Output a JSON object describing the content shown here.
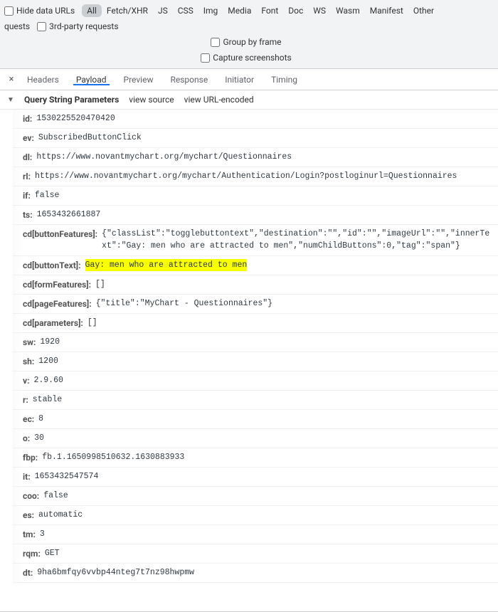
{
  "filterbar": {
    "hide_data_urls": "Hide data URLs",
    "chips": [
      "All",
      "Fetch/XHR",
      "JS",
      "CSS",
      "Img",
      "Media",
      "Font",
      "Doc",
      "WS",
      "Wasm",
      "Manifest",
      "Other"
    ],
    "active_chip": "All",
    "requests_suffix": "quests",
    "third_party": "3rd-party requests",
    "group_by_frame": "Group by frame",
    "capture_screenshots": "Capture screenshots"
  },
  "tabs": {
    "items": [
      "Headers",
      "Payload",
      "Preview",
      "Response",
      "Initiator",
      "Timing"
    ],
    "active": "Payload",
    "close": "×"
  },
  "section": {
    "caret": "▼",
    "title": "Query String Parameters",
    "view_source": "view source",
    "view_url_encoded": "view URL-encoded"
  },
  "params": [
    {
      "key": "id:",
      "val": "1530225520470420"
    },
    {
      "key": "ev:",
      "val": "SubscribedButtonClick"
    },
    {
      "key": "dl:",
      "val": "https://www.novantmychart.org/mychart/Questionnaires"
    },
    {
      "key": "rl:",
      "val": "https://www.novantmychart.org/mychart/Authentication/Login?postloginurl=Questionnaires"
    },
    {
      "key": "if:",
      "val": "false"
    },
    {
      "key": "ts:",
      "val": "1653432661887"
    },
    {
      "key": "cd[buttonFeatures]:",
      "val": "{\"classList\":\"togglebuttontext\",\"destination\":\"\",\"id\":\"\",\"imageUrl\":\"\",\"innerText\":\"Gay: men who are attracted to men\",\"numChildButtons\":0,\"tag\":\"span\"}"
    },
    {
      "key": "cd[buttonText]:",
      "val": "Gay: men who are attracted to men",
      "highlight": true
    },
    {
      "key": "cd[formFeatures]:",
      "val": "[]"
    },
    {
      "key": "cd[pageFeatures]:",
      "val": "{\"title\":\"MyChart - Questionnaires\"}"
    },
    {
      "key": "cd[parameters]:",
      "val": "[]"
    },
    {
      "key": "sw:",
      "val": "1920"
    },
    {
      "key": "sh:",
      "val": "1200"
    },
    {
      "key": "v:",
      "val": "2.9.60"
    },
    {
      "key": "r:",
      "val": "stable"
    },
    {
      "key": "ec:",
      "val": "8"
    },
    {
      "key": "o:",
      "val": "30"
    },
    {
      "key": "fbp:",
      "val": "fb.1.1650998510632.1630883933"
    },
    {
      "key": "it:",
      "val": "1653432547574"
    },
    {
      "key": "coo:",
      "val": "false"
    },
    {
      "key": "es:",
      "val": "automatic"
    },
    {
      "key": "tm:",
      "val": "3"
    },
    {
      "key": "rqm:",
      "val": "GET"
    },
    {
      "key": "dt:",
      "val": "9ha6bmfqy6vvbp44nteg7t7nz98hwpmw"
    }
  ]
}
